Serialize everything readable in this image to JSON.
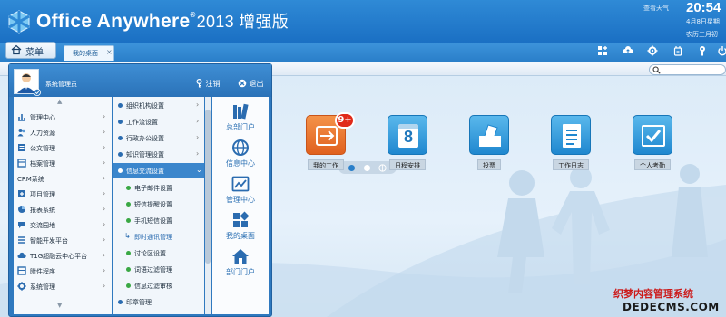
{
  "header": {
    "title_main": "Office Anywhere",
    "title_reg": "®",
    "title_version": "2013 增强版",
    "weather_link": "查看天气",
    "clock": "20:54",
    "date": "4月8日星期",
    "lunar": "农历三月初",
    "colors": {
      "header_bg": "#1f78c8",
      "accent": "#2f79bf"
    }
  },
  "tabbar": {
    "menu_label": "菜单",
    "tabs": [
      {
        "label": "我的桌面",
        "close": "×"
      }
    ],
    "tools": [
      "add-widget-icon",
      "cloud-upload-icon",
      "settings-icon",
      "theme-icon",
      "help-icon",
      "power-icon"
    ]
  },
  "user": {
    "name": "系统管理员",
    "logout_label": "注销",
    "exit_label": "退出"
  },
  "menu_level1": [
    {
      "label": "管理中心",
      "icon": "gauge-icon"
    },
    {
      "label": "人力资源",
      "icon": "people-icon"
    },
    {
      "label": "公文管理",
      "icon": "document-icon"
    },
    {
      "label": "档案管理",
      "icon": "archive-icon"
    },
    {
      "label": "CRM系统",
      "icon": "crm-icon"
    },
    {
      "label": "项目管理",
      "icon": "project-icon"
    },
    {
      "label": "报表系统",
      "icon": "report-icon"
    },
    {
      "label": "交流园地",
      "icon": "chat-icon"
    },
    {
      "label": "智能开发平台",
      "icon": "dev-platform-icon"
    },
    {
      "label": "T1G超融云中心平台",
      "icon": "cloud-icon"
    },
    {
      "label": "附件程序",
      "icon": "attachment-icon"
    },
    {
      "label": "系统管理",
      "icon": "gear-icon"
    }
  ],
  "menu_level2": [
    {
      "label": "组织机构设置",
      "type": "parent"
    },
    {
      "label": "工作流设置",
      "type": "parent"
    },
    {
      "label": "行政办公设置",
      "type": "parent"
    },
    {
      "label": "知识管理设置",
      "type": "parent"
    },
    {
      "label": "信息交流设置",
      "type": "active"
    },
    {
      "label": "电子邮件设置",
      "type": "sub"
    },
    {
      "label": "短信提醒设置",
      "type": "sub"
    },
    {
      "label": "手机短信设置",
      "type": "sub"
    },
    {
      "label": "即时通讯管理",
      "type": "link"
    },
    {
      "label": "讨论区设置",
      "type": "sub"
    },
    {
      "label": "词语过滤管理",
      "type": "sub"
    },
    {
      "label": "信息过滤审核",
      "type": "sub"
    },
    {
      "label": "印章管理",
      "type": "plain"
    }
  ],
  "menu_level3": [
    {
      "label": "总部门户",
      "icon": "books-icon"
    },
    {
      "label": "信息中心",
      "icon": "globe-icon"
    },
    {
      "label": "管理中心",
      "icon": "chart-line-icon"
    },
    {
      "label": "我的桌面",
      "icon": "desktop-icon"
    },
    {
      "label": "部门门户",
      "icon": "house-icon"
    }
  ],
  "apps": [
    {
      "label": "我的工作",
      "icon": "my-work-icon",
      "badge": "9+"
    },
    {
      "label": "日程安排",
      "icon": "calendar-icon",
      "glyph": "8"
    },
    {
      "label": "投票",
      "icon": "vote-icon"
    },
    {
      "label": "工作日志",
      "icon": "work-log-icon"
    },
    {
      "label": "个人考勤",
      "icon": "attendance-icon"
    }
  ],
  "watermark": {
    "text": "织梦内容管理系统",
    "url": "DEDECMS.COM"
  }
}
